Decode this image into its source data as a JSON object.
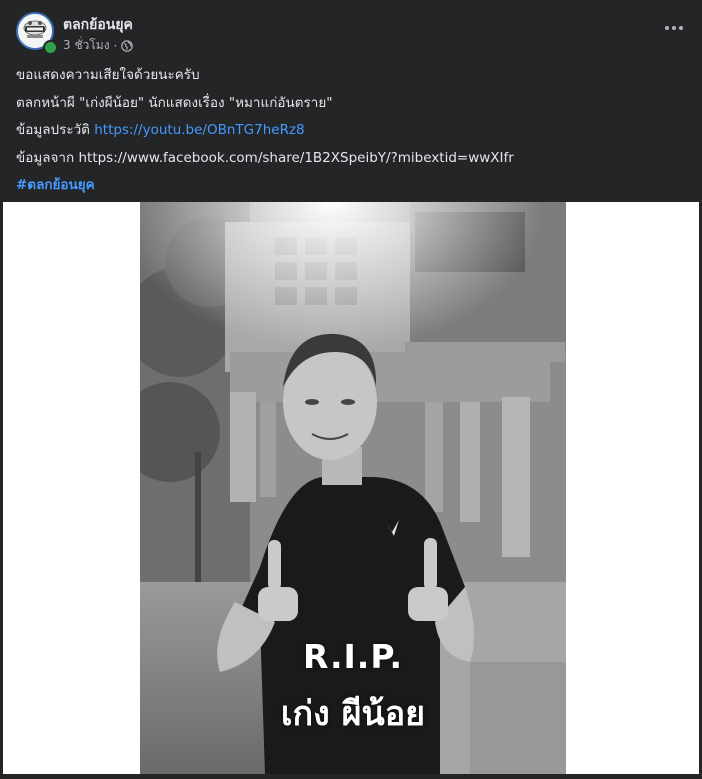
{
  "post": {
    "page_name": "ตลกย้อนยุค",
    "time": "3 ชั่วโมง",
    "separator": "·",
    "privacy_icon": "globe-icon",
    "more_icon": "more-horizontal-icon"
  },
  "body": {
    "line1": "ขอแสดงความเสียใจด้วยนะครับ",
    "line2": "ตลกหน้าผี \"เก่งผีน้อย\" นักแสดงเรื่อง \"หมาแก่อันตราย\"",
    "line3_prefix": "ข้อมูลประวัติ ",
    "line3_link": "https://youtu.be/OBnTG7heRz8",
    "line4": "ข้อมูลจาก https://www.facebook.com/share/1B2XSpeibY/?mibextid=wwXIfr",
    "hashtag": "#ตลกย้อนยุค"
  },
  "photo": {
    "rip_line1": "R.I.P.",
    "rip_line2": "เก่ง ผีน้อย"
  },
  "colors": {
    "background": "#242526",
    "text": "#e4e6eb",
    "secondary": "#b0b3b8",
    "link": "#4599ff",
    "online": "#31a24c"
  }
}
